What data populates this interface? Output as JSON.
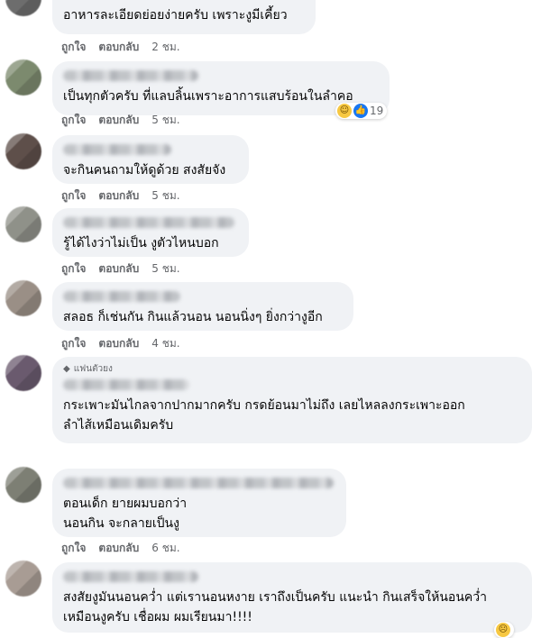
{
  "comments": [
    {
      "text_lines": [
        "อาหารละเอียดย่อยง่ายครับ เพราะงูมีเคี้ยว"
      ],
      "like": "ถูกใจ",
      "reply": "ตอบกลับ",
      "time": "2 ชม.",
      "avatar_color": "#6d6d6d"
    },
    {
      "text_lines": [
        "เป็นทุกตัวครับ ที่แลบลิ้นเพราะอาการแสบร้อนในลำคอ"
      ],
      "like": "ถูกใจ",
      "reply": "ตอบกลับ",
      "time": "5 ชม.",
      "reaction_count": "19",
      "avatar_color": "#7c8a6e"
    },
    {
      "text_lines": [
        "จะกินคนถามให้ดูด้วย สงสัยจัง"
      ],
      "like": "ถูกใจ",
      "reply": "ตอบกลับ",
      "time": "5 ชม.",
      "avatar_color": "#5e4f4a"
    },
    {
      "text_lines": [
        "รู้ได้ไงว่าไม่เป็น งูตัวไหนบอก"
      ],
      "like": "ถูกใจ",
      "reply": "ตอบกลับ",
      "time": "5 ชม.",
      "avatar_color": "#8f9189"
    },
    {
      "text_lines": [
        "สลอธ ก็เช่นกัน กินแล้วนอน นอนนิ่งๆ ยิ่งกว่างูอีก"
      ],
      "like": "ถูกใจ",
      "reply": "ตอบกลับ",
      "time": "4 ชม.",
      "avatar_color": "#9a8f86"
    },
    {
      "badge": "แฟนตัวยง",
      "text_lines": [
        "กระเพาะมันไกลจากปากมากครับ กรดย้อนมาไม่ถึง เลยไหลลงกระเพาะออก",
        "ลำไส้เหมือนเดิมครับ"
      ],
      "avatar_color": "#6a5a6e"
    },
    {
      "text_lines": [
        "ตอนเด็ก ยายผมบอกว่า",
        "นอนกิน จะกลายเป็นงู"
      ],
      "like": "ถูกใจ",
      "reply": "ตอบกลับ",
      "time": "6 ชม.",
      "avatar_color": "#7d7f74"
    },
    {
      "text_lines": [
        "สงสัยงูมันนอนคว่ำ แต่เรานอนหงาย เราถึงเป็นครับ แนะนำ กินเสร็จให้นอนคว่ำ",
        "เหมือนงูครับ เชื่อผม ผมเรียนมา!!!!"
      ],
      "avatar_color": "#a89c94"
    }
  ]
}
